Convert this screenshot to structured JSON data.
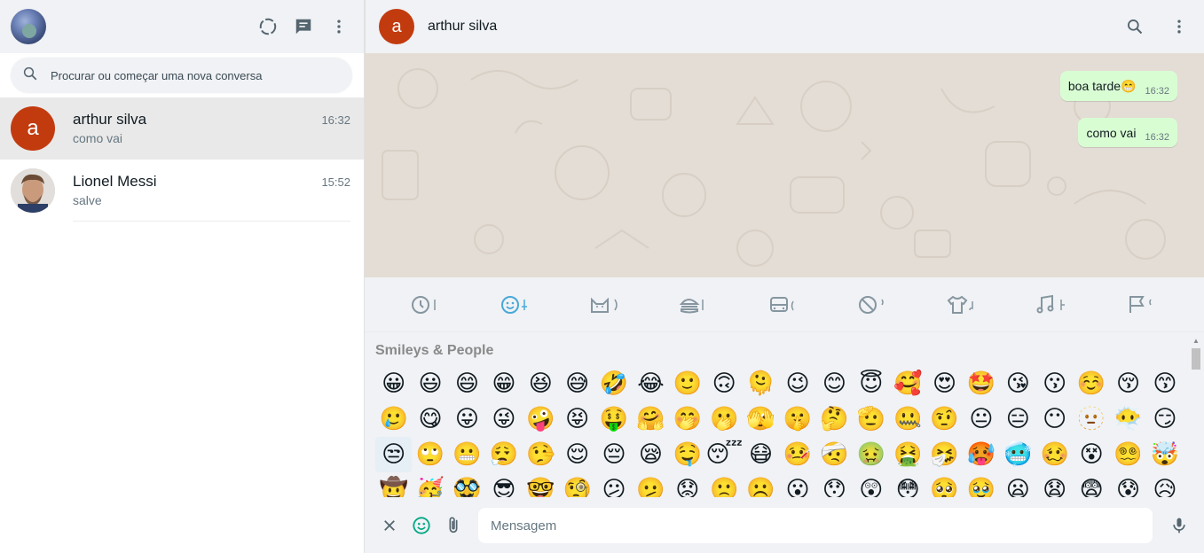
{
  "sidebar": {
    "search_placeholder": "Procurar ou começar uma nova conversa",
    "chats": [
      {
        "avatar_letter": "a",
        "avatar_color": "#c23b0f",
        "name": "arthur silva",
        "time": "16:32",
        "last_message": "como vai"
      },
      {
        "avatar_letter": "",
        "avatar_color": "#6b6b6b",
        "name": "Lionel Messi",
        "time": "15:52",
        "last_message": "salve"
      }
    ]
  },
  "chat": {
    "contact_letter": "a",
    "contact_name": "arthur silva",
    "messages": [
      {
        "text": "boa tarde😁",
        "time": "16:32",
        "outgoing": true
      },
      {
        "text": "como vai",
        "time": "16:32",
        "outgoing": true
      }
    ]
  },
  "emoji_panel": {
    "tabs": [
      "recent-icon",
      "smiley-icon",
      "cat-icon",
      "food-icon",
      "bus-icon",
      "ball-icon",
      "shirt-icon",
      "music-icon",
      "flag-icon"
    ],
    "active_tab": "smiley-icon",
    "section_title": "Smileys & People",
    "rows": [
      [
        "😀",
        "😃",
        "😄",
        "😁",
        "😆",
        "😅",
        "🤣",
        "😂",
        "🙂",
        "🙃",
        "🫠",
        "😉",
        "😊",
        "😇",
        "🥰",
        "😍",
        "🤩",
        "😘",
        "😗",
        "☺️",
        "😚",
        "😙"
      ],
      [
        "🥲",
        "😋",
        "😛",
        "😜",
        "🤪",
        "😝",
        "🤑",
        "🤗",
        "🤭",
        "🫢",
        "🫣",
        "🤫",
        "🤔",
        "🫡",
        "🤐",
        "🤨",
        "😐",
        "😑",
        "😶",
        "🫥",
        "😶‍🌫️",
        "😏"
      ],
      [
        "😒",
        "🙄",
        "😬",
        "😮‍💨",
        "🤥",
        "😌",
        "😔",
        "😪",
        "🤤",
        "😴",
        "😷",
        "🤒",
        "🤕",
        "🤢",
        "🤮",
        "🤧",
        "🥵",
        "🥶",
        "🥴",
        "😵",
        "😵‍💫",
        "🤯"
      ],
      [
        "🤠",
        "🥳",
        "🥸",
        "😎",
        "🤓",
        "🧐",
        "😕",
        "🫤",
        "😟",
        "🙁",
        "☹️",
        "😮",
        "😯",
        "😲",
        "😳",
        "🥺",
        "🥹",
        "😦",
        "😧",
        "😨",
        "😰",
        "😥"
      ]
    ]
  },
  "compose": {
    "placeholder": "Mensagem"
  }
}
